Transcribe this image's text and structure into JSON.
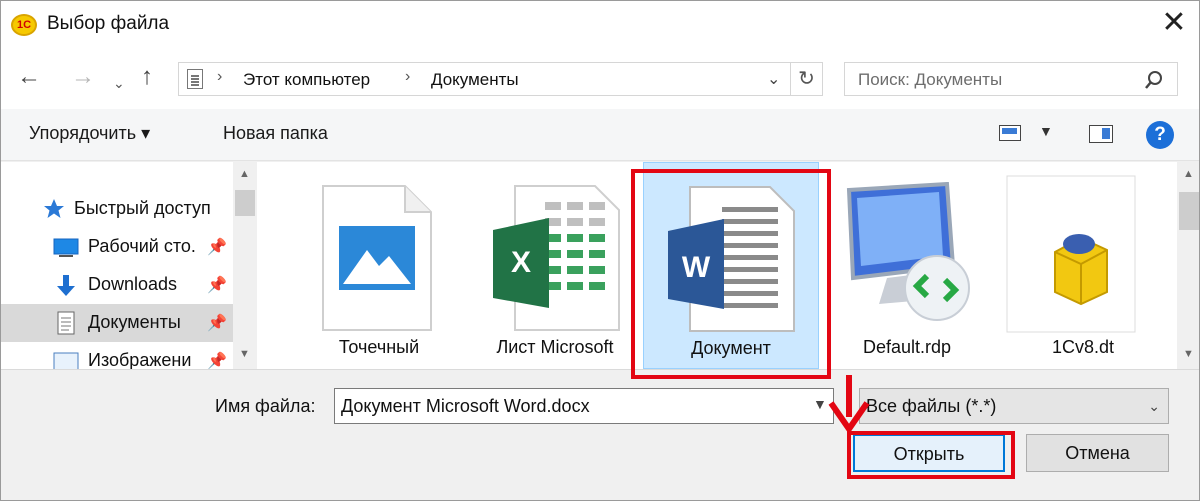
{
  "window": {
    "title": "Выбор файла",
    "app_logo": "1С",
    "close_glyph": "✕"
  },
  "nav": {
    "back": "←",
    "forward": "→",
    "history": "⌄",
    "up": "↑",
    "breadcrumb": [
      "Этот компьютер",
      "Документы"
    ],
    "breadcrumb_sep": "›",
    "search_placeholder": "Поиск: Документы"
  },
  "toolbar": {
    "organize": "Упорядочить ▾",
    "new_folder": "Новая папка",
    "help": "?"
  },
  "sidebar": {
    "items": [
      {
        "label": "Быстрый доступ",
        "icon": "star-icon"
      },
      {
        "label": "Рабочий сто.",
        "icon": "desktop-icon",
        "pinned": true
      },
      {
        "label": "Downloads",
        "icon": "download-icon",
        "pinned": true
      },
      {
        "label": "Документы",
        "icon": "documents-icon",
        "pinned": true,
        "selected": true
      },
      {
        "label": "Изображени",
        "icon": "pictures-icon",
        "pinned": true
      }
    ]
  },
  "files": [
    {
      "label": "Точечный",
      "icon": "image-file-icon"
    },
    {
      "label": "Лист Microsoft",
      "icon": "excel-file-icon"
    },
    {
      "label": "Документ",
      "icon": "word-file-icon",
      "selected": true
    },
    {
      "label": "Default.rdp",
      "icon": "rdp-file-icon"
    },
    {
      "label": "1Cv8.dt",
      "icon": "1c-dt-file-icon"
    }
  ],
  "bottom": {
    "filename_label": "Имя файла:",
    "filename_value": "Документ Microsoft Word.docx",
    "filter_value": "Все файлы (*.*)",
    "open_button": "Открыть",
    "cancel_button": "Отмена"
  },
  "colors": {
    "accent": "#0078d7",
    "highlight_frame": "#e30613",
    "selection": "#cce8ff"
  }
}
